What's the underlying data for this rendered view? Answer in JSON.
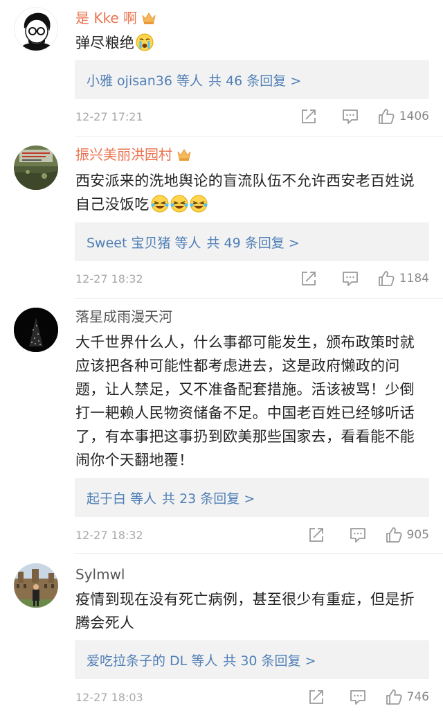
{
  "comments": [
    {
      "username": "是 Kke 啊",
      "vip": true,
      "text": "弹尽粮绝",
      "emojis": [
        "crying-face"
      ],
      "reply_users": "小雅 ojisan36 等人",
      "reply_count": "共 46 条回复 >",
      "time": "12-27 17:21",
      "likes": "1406"
    },
    {
      "username": "振兴美丽洪园村",
      "vip": true,
      "text": "西安派来的洗地舆论的盲流队伍不允许西安老百姓说自己没饭吃",
      "emojis": [
        "laughing-crying-face",
        "laughing-crying-face",
        "laughing-crying-face"
      ],
      "reply_users": "Sweet 宝贝猪 等人",
      "reply_count": "共 49 条回复 >",
      "time": "12-27 18:32",
      "likes": "1184"
    },
    {
      "username": "落星成雨漫天河",
      "vip": false,
      "text": "大千世界什么人，什么事都可能发生，颁布政策时就应该把各种可能性都考虑进去，这是政府懒政的问题，让人禁足，又不准备配套措施。活该被骂！少倒打一耙赖人民物资储备不足。中国老百姓已经够听话了，有本事把这事扔到欧美那些国家去，看看能不能闹你个天翻地覆！",
      "emojis": [],
      "reply_users": "起于白 等人",
      "reply_count": "共 23 条回复 >",
      "time": "12-27 18:32",
      "likes": "905"
    },
    {
      "username": "Sylmwl",
      "vip": false,
      "text": "疫情到现在没有死亡病例，甚至很少有重症，但是折腾会死人",
      "emojis": [],
      "reply_users": "爱吃拉条子的 DL 等人",
      "reply_count": "共 30 条回复 >",
      "time": "12-27 18:03",
      "likes": "746"
    }
  ],
  "icons": {
    "share": "share-icon",
    "comment": "comment-icon",
    "like": "thumb-up-icon",
    "vip": "crown-icon"
  },
  "colors": {
    "vip_name": "#eb7350",
    "link": "#4f7fb6",
    "meta": "#aaaaaa",
    "reply_bg": "#f2f2f2"
  }
}
